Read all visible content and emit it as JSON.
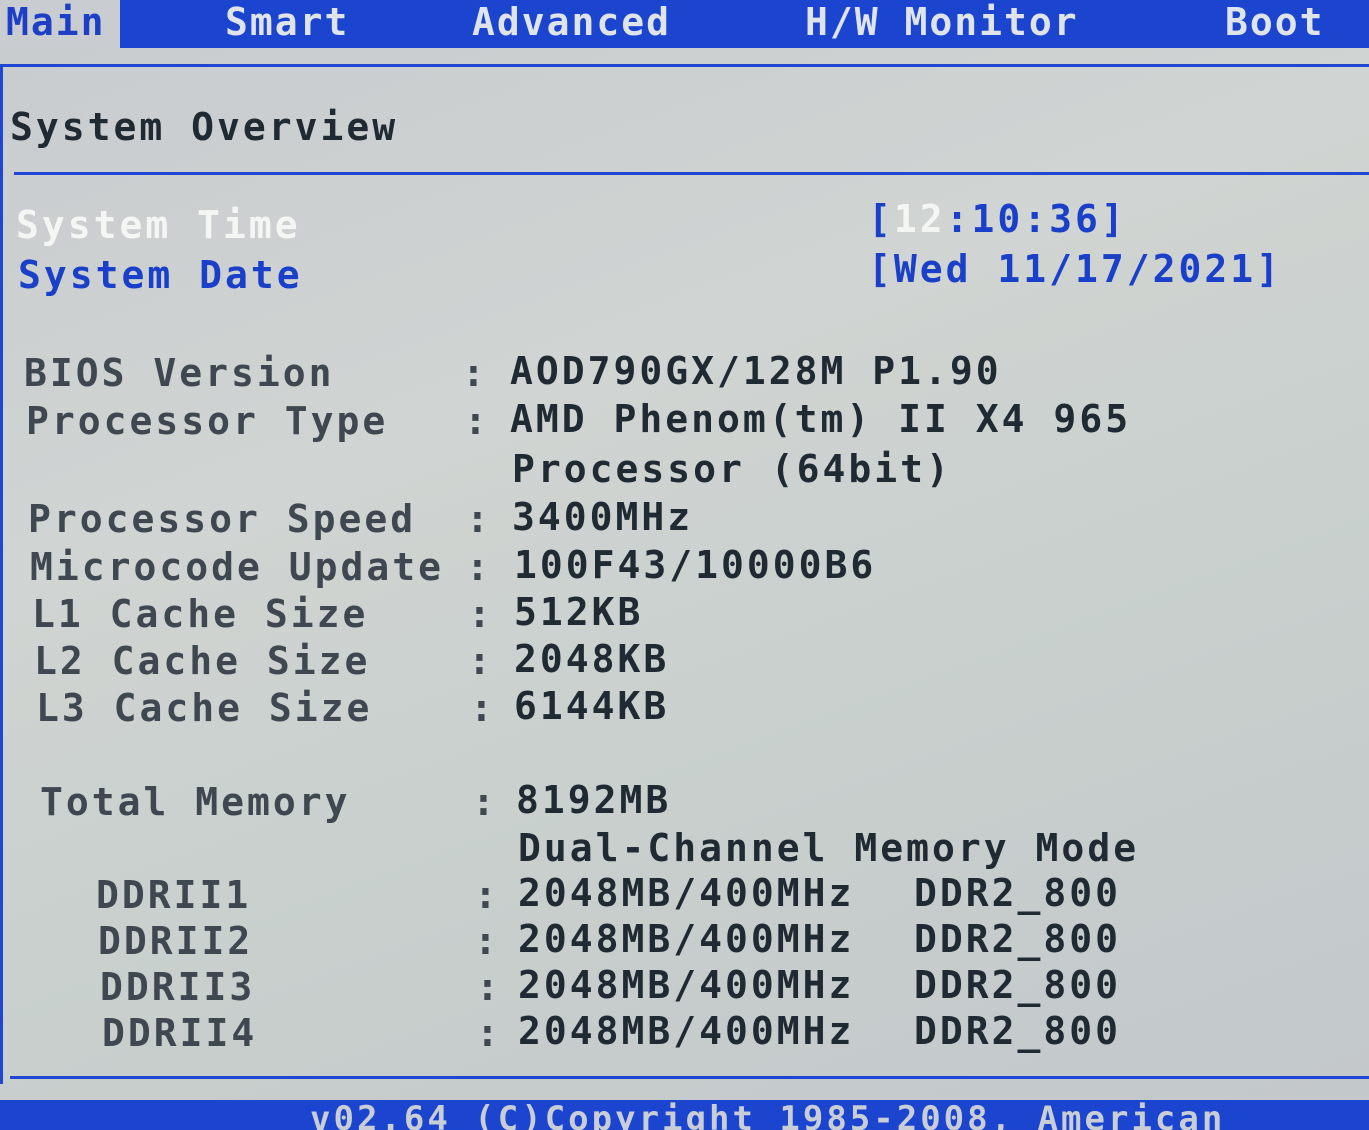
{
  "tabs": [
    {
      "label": "Main",
      "active": true
    },
    {
      "label": "Smart",
      "active": false
    },
    {
      "label": "Advanced",
      "active": false
    },
    {
      "label": "H/W Monitor",
      "active": false
    },
    {
      "label": "Boot",
      "active": false
    }
  ],
  "section_title": "System Overview",
  "system_time": {
    "label": "System Time",
    "open_bracket": "[",
    "hour": "12",
    "rest": ":10:36]"
  },
  "system_date": {
    "label": "System Date",
    "value": "[Wed 11/17/2021]"
  },
  "info": [
    {
      "label": "BIOS Version",
      "value": "AOD790GX/128M P1.90"
    },
    {
      "label": "Processor Type",
      "value": "AMD Phenom(tm) II X4 965",
      "value_line2": "Processor (64bit)"
    },
    {
      "label": "Processor Speed",
      "value": "3400MHz"
    },
    {
      "label": "Microcode Update",
      "value": "100F43/10000B6"
    },
    {
      "label": "L1 Cache Size",
      "value": "512KB"
    },
    {
      "label": "L2 Cache Size",
      "value": "2048KB"
    },
    {
      "label": "L3 Cache Size",
      "value": "6144KB"
    }
  ],
  "memory": {
    "label": "Total Memory",
    "value": "8192MB",
    "mode": "Dual-Channel Memory Mode",
    "slots": [
      {
        "label": "DDRII1",
        "size": "2048MB/400MHz",
        "type": "DDR2_800"
      },
      {
        "label": "DDRII2",
        "size": "2048MB/400MHz",
        "type": "DDR2_800"
      },
      {
        "label": "DDRII3",
        "size": "2048MB/400MHz",
        "type": "DDR2_800"
      },
      {
        "label": "DDRII4",
        "size": "2048MB/400MHz",
        "type": "DDR2_800"
      }
    ]
  },
  "separator": ":",
  "footer": "v02.64 (C)Copyright 1985-2008, American",
  "colors": {
    "bios_blue": "#1b44cf",
    "panel_grey": "#c9cdd1",
    "highlight_white": "#f4f6f4",
    "label_dark": "#1f2a33"
  }
}
